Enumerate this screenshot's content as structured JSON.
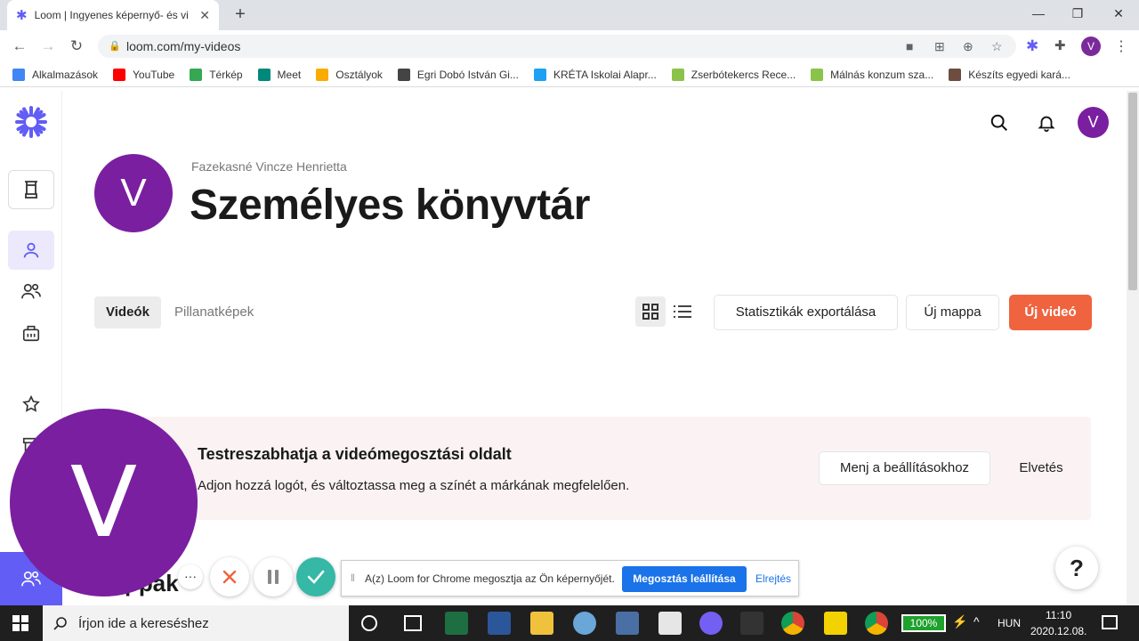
{
  "browser": {
    "tab_title": "Loom | Ingyenes képernyő- és vi",
    "url": "loom.com/my-videos",
    "profile_initial": "V",
    "bookmarks": [
      {
        "label": "Alkalmazások",
        "color": "#4285f4"
      },
      {
        "label": "YouTube",
        "color": "#ff0000"
      },
      {
        "label": "Térkép",
        "color": "#34a853"
      },
      {
        "label": "Meet",
        "color": "#00897b"
      },
      {
        "label": "Osztályok",
        "color": "#f9ab00"
      },
      {
        "label": "Egri Dobó István Gi...",
        "color": "#444444"
      },
      {
        "label": "KRÉTA Iskolai Alapr...",
        "color": "#1da1f2"
      },
      {
        "label": "Zserbótekercs Rece...",
        "color": "#8bc34a"
      },
      {
        "label": "Málnás konzum sza...",
        "color": "#8bc34a"
      },
      {
        "label": "Készíts egyedi kará...",
        "color": "#6d4c41"
      }
    ]
  },
  "page": {
    "owner": "Fazekasné Vincze Henrietta",
    "title": "Személyes könyvtár",
    "avatar_initial": "V",
    "tabs": [
      {
        "label": "Videók",
        "active": true
      },
      {
        "label": "Pillanatképek",
        "active": false
      }
    ],
    "buttons": {
      "export": "Statisztikák exportálása",
      "new_folder": "Új mappa",
      "new_video": "Új videó"
    },
    "banner": {
      "title": "Testreszabhatja a videómegosztási oldalt",
      "text": "Adjon hozzá logót, és változtassa meg a színét a márkának megfelelően.",
      "settings_button": "Menj a beállításokhoz",
      "dismiss_button": "Elvetés"
    },
    "section_partial": "ppák",
    "help_label": "?"
  },
  "recorder": {
    "bubble_initial": "V",
    "more_label": "···"
  },
  "share_bar": {
    "text": "A(z) Loom for Chrome megosztja az Ön képernyőjét.",
    "stop_label": "Megosztás leállítása",
    "hide_label": "Elrejtés"
  },
  "taskbar": {
    "search_placeholder": "Írjon ide a kereséshez",
    "battery": "100%",
    "lang": "HUN",
    "time": "11:10",
    "date": "2020.12.08."
  },
  "colors": {
    "accent": "#7a1fa0",
    "primary_button": "#f0633f",
    "loom_brand": "#625df5"
  }
}
